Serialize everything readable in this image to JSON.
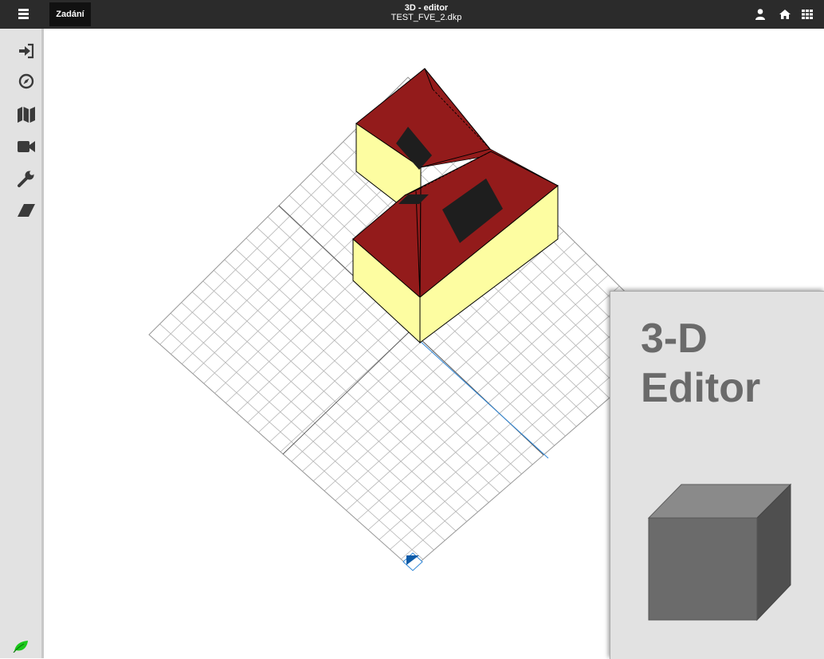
{
  "header": {
    "tab_label": "Zadání",
    "title": "3D - editor",
    "filename": "TEST_FVE_2.dkp",
    "icons": [
      "menu-icon",
      "user-icon",
      "home-icon",
      "grid-apps-icon"
    ]
  },
  "sidebar": {
    "icons": [
      "sign-in-icon",
      "compass-icon",
      "map-icon",
      "video-camera-icon",
      "wrench-icon",
      "eraser-icon"
    ],
    "bottom_icon": "leaf-icon"
  },
  "badge": {
    "line1": "3-D",
    "line2": "Editor",
    "icon": "cube-icon"
  },
  "scene": {
    "roof_color": "#931b1b",
    "wall_color": "#fdfda1",
    "window_color": "#1e1e1e",
    "grid_color": "#b4b4b4",
    "axis_color": "#2f86d6"
  }
}
